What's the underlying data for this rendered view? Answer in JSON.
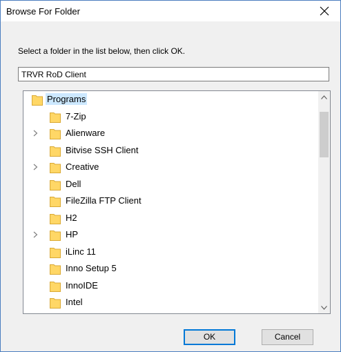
{
  "window": {
    "title": "Browse For Folder"
  },
  "dialog": {
    "instruction": "Select a folder in the list below, then click OK.",
    "folder_name_value": "TRVR RoD Client"
  },
  "tree": {
    "root": {
      "label": "Programs",
      "selected": true
    },
    "items": [
      {
        "label": "7-Zip",
        "expandable": false
      },
      {
        "label": "Alienware",
        "expandable": true
      },
      {
        "label": "Bitvise SSH Client",
        "expandable": false
      },
      {
        "label": "Creative",
        "expandable": true
      },
      {
        "label": "Dell",
        "expandable": false
      },
      {
        "label": "FileZilla FTP Client",
        "expandable": false
      },
      {
        "label": "H2",
        "expandable": false
      },
      {
        "label": "HP",
        "expandable": true
      },
      {
        "label": "iLinc 11",
        "expandable": false
      },
      {
        "label": "Inno Setup 5",
        "expandable": false
      },
      {
        "label": "InnoIDE",
        "expandable": false
      },
      {
        "label": "Intel",
        "expandable": false
      }
    ]
  },
  "buttons": {
    "ok": "OK",
    "cancel": "Cancel"
  },
  "colors": {
    "window_border": "#4a7dbf",
    "folder_fill": "#ffd766",
    "selection": "#cce8ff",
    "ok_border": "#0078d7"
  }
}
